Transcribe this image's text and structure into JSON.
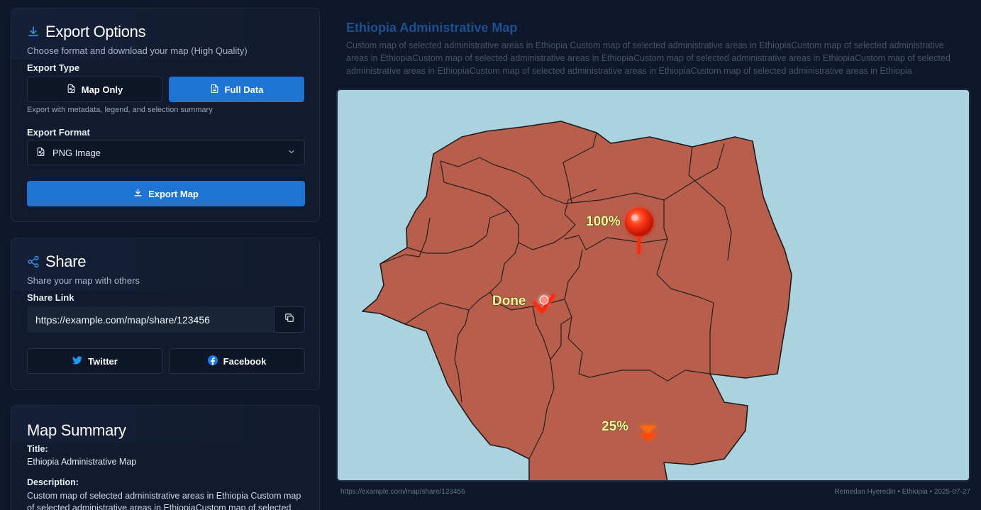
{
  "export": {
    "title": "Export Options",
    "subtitle": "Choose format and download your map (High Quality)",
    "type_label": "Export Type",
    "map_only_label": "Map Only",
    "full_data_label": "Full Data",
    "hint": "Export with metadata, legend, and selection summary",
    "format_label": "Export Format",
    "format_value": "PNG Image",
    "export_button": "Export Map"
  },
  "share": {
    "title": "Share",
    "subtitle": "Share your map with others",
    "link_label": "Share Link",
    "link_value": "https://example.com/map/share/123456",
    "twitter_label": "Twitter",
    "facebook_label": "Facebook"
  },
  "summary": {
    "title": "Map Summary",
    "title_label": "Title:",
    "title_value": "Ethiopia Administrative Map",
    "description_label": "Description:",
    "description_value": "Custom map of selected administrative areas in Ethiopia Custom map of selected administrative areas in EthiopiaCustom map of selected"
  },
  "map": {
    "title": "Ethiopia Administrative Map",
    "description": "Custom map of selected administrative areas in Ethiopia Custom map of selected administrative areas in EthiopiaCustom map of selected administrative areas in EthiopiaCustom map of selected administrative areas in EthiopiaCustom map of selected administrative areas in EthiopiaCustom map of selected administrative areas in EthiopiaCustom map of selected administrative areas in EthiopiaCustom map of selected administrative areas in Ethiopia",
    "marker_labels": {
      "pin": "100%",
      "check": "Done",
      "arrow": "25%"
    },
    "footer_link": "https://example.com/map/share/123456",
    "footer_credit": "Remedan Hyeredin • Ethiopia • 2025-07-27"
  },
  "colors": {
    "accent": "#1e74d3",
    "region_fill": "#b75f4c",
    "water": "#aad3df",
    "facebook": "#1877f2",
    "twitter": "#1d9bf0",
    "marker_red": "#ff2a10"
  },
  "icons": [
    "download-icon",
    "file-image-icon",
    "file-text-icon",
    "chevron-down-icon",
    "share-icon",
    "copy-icon",
    "twitter-icon",
    "facebook-icon"
  ]
}
